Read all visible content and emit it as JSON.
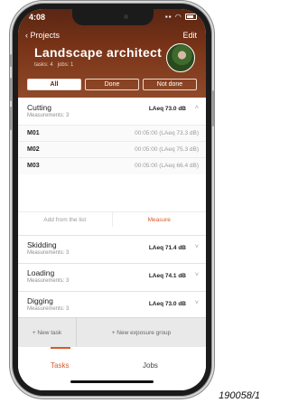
{
  "status": {
    "time": "4:08"
  },
  "nav": {
    "back_label": "Projects",
    "edit_label": "Edit"
  },
  "project": {
    "title": "Landscape architect",
    "tasks_text": "tasks: 4",
    "jobs_text": "jobs: 1"
  },
  "filter": {
    "options": [
      "All",
      "Done",
      "Not done"
    ],
    "selected": "All"
  },
  "groups": [
    {
      "name": "Cutting",
      "measurements": "Measurements: 3",
      "level": "LAeq 73.0 dB",
      "expanded": true,
      "rows": [
        {
          "id": "M01",
          "value": "00:05:00 (LAeq 73.3 dB)"
        },
        {
          "id": "M02",
          "value": "00:05:00 (LAeq 75.3 dB)"
        },
        {
          "id": "M03",
          "value": "00:05:00 (LAeq 66.4 dB)"
        }
      ],
      "actions": {
        "add_label": "Add from the list",
        "measure_label": "Measure"
      }
    },
    {
      "name": "Skidding",
      "measurements": "Measurements: 3",
      "level": "LAeq 71.4 dB",
      "expanded": false
    },
    {
      "name": "Loading",
      "measurements": "Measurements: 3",
      "level": "LAeq 74.1 dB",
      "expanded": false
    },
    {
      "name": "Digging",
      "measurements": "Measurements: 3",
      "level": "LAeq 73.0 dB",
      "expanded": false
    }
  ],
  "bottom_actions": {
    "new_task": "+ New task",
    "new_exposure_group": "+ New exposure group"
  },
  "tabs": {
    "tasks": "Tasks",
    "jobs": "Jobs"
  },
  "figure_label": "190058/1",
  "colors": {
    "header": "#7a3418",
    "accent": "#d65a2a"
  }
}
